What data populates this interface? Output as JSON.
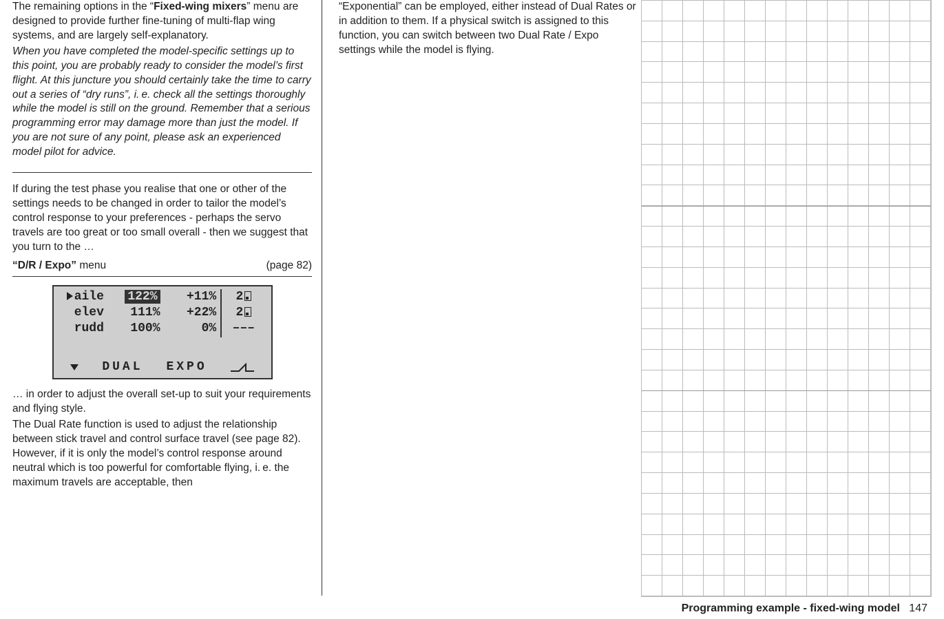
{
  "col1": {
    "p1_pre": "The remaining options in the “",
    "p1_bold": "Fixed-wing mixers",
    "p1_post": "” menu are designed to provide further fine-tuning of multi-flap wing systems, and are largely self-explanatory.",
    "p2_ital": "When you have completed the model-specific settings up to this point, you are probably ready to consider the model’s first flight. At this juncture you should certainly take the time to carry out a series of “dry runs”, i. e. check all the settings thoroughly while the model is still on the ground. Remember that a serious programming error may damage more than just the model. If you are not sure of any point, please ask an experienced model pilot for advice.",
    "p3": "If during the test phase you realise that one or other of the settings needs to be changed in order to tailor the model’s control response to your preferences - perhaps the servo travels are too great or too small overall - then we suggest that you turn to the …",
    "menu_label_bold": "“D/R / Expo”",
    "menu_label_rest": " menu",
    "menu_page": "(page 82)",
    "lcd": {
      "rows": [
        {
          "ch": "aile",
          "dr": "122%",
          "expo": "+11%",
          "sw": "2",
          "sel": true,
          "pointer": true
        },
        {
          "ch": "elev",
          "dr": "111%",
          "expo": "+22%",
          "sw": "2",
          "sel": false,
          "pointer": false
        },
        {
          "ch": "rudd",
          "dr": "100%",
          "expo": "0%",
          "sw": "–––",
          "sel": false,
          "pointer": false
        }
      ],
      "footer_left": "DUAL",
      "footer_right": "EXPO"
    },
    "p4": "… in order to adjust the overall set-up to suit your requirements and flying style.",
    "p5": "The Dual Rate function is used to adjust the relationship between stick travel and control surface travel (see page 82). However, if it is only the model’s control response around neutral which is too powerful for comfortable flying, i. e. the maximum travels are acceptable, then"
  },
  "col2": {
    "p1": "“Exponential” can be employed, either instead of Dual Rates or in addition to them. If a physical switch is assigned to this function, you can switch between two Dual Rate / Expo settings while the model is flying."
  },
  "footer": {
    "title": "Programming example - fixed-wing model",
    "page": "147"
  }
}
